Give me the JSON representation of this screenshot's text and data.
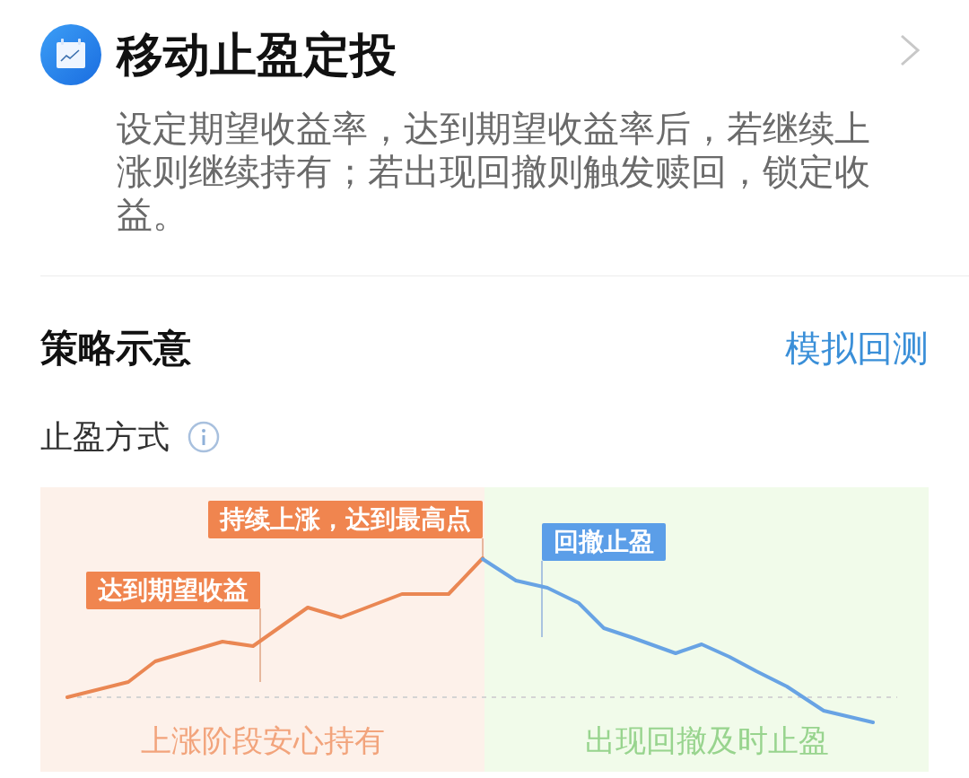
{
  "header": {
    "title": "移动止盈定投",
    "description": "设定期望收益率，达到期望收益率后，若继续上涨则继续持有；若出现回撤则触发赎回，锁定收益。"
  },
  "strategy": {
    "title": "策略示意",
    "action": "模拟回测",
    "subtitle": "止盈方式"
  },
  "illustration": {
    "phases": [
      {
        "kind": "rise",
        "label": "上涨阶段安心持有"
      },
      {
        "kind": "pullback",
        "label": "出现回撤及时止盈"
      }
    ],
    "callouts": [
      {
        "kind": "rise",
        "label": "达到期望收益"
      },
      {
        "kind": "rise",
        "label": "持续上涨，达到最高点"
      },
      {
        "kind": "pullback",
        "label": "回撤止盈"
      }
    ]
  }
}
